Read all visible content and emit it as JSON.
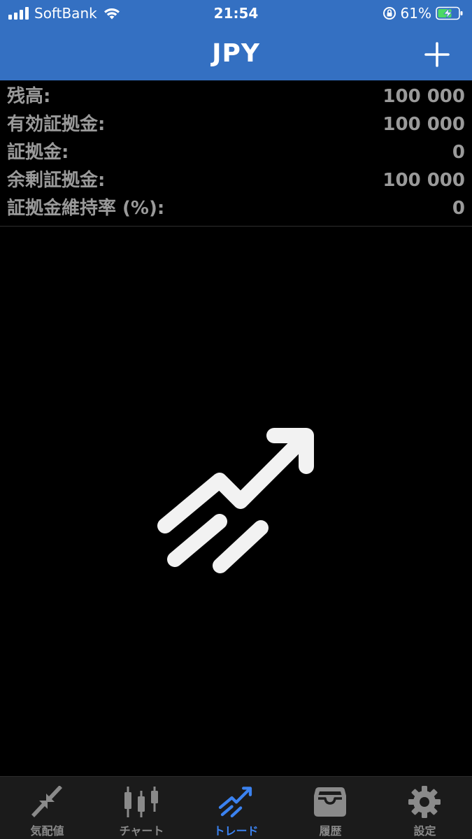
{
  "status_bar": {
    "carrier": "SoftBank",
    "time": "21:54",
    "battery_percent": "61%"
  },
  "nav": {
    "title": "JPY",
    "add_icon": "plus-icon"
  },
  "account": {
    "rows": [
      {
        "label": "残高:",
        "value": "100 000"
      },
      {
        "label": "有効証拠金:",
        "value": "100 000"
      },
      {
        "label": "証拠金:",
        "value": "0"
      },
      {
        "label": "余剰証拠金:",
        "value": "100 000"
      },
      {
        "label": "証拠金維持率 (%):",
        "value": "0"
      }
    ]
  },
  "empty_state": {
    "icon": "trade-trend-icon"
  },
  "tabbar": {
    "tabs": [
      {
        "label": "気配値",
        "icon": "quotes-icon",
        "active": false
      },
      {
        "label": "チャート",
        "icon": "candlestick-icon",
        "active": false
      },
      {
        "label": "トレード",
        "icon": "trade-icon",
        "active": true
      },
      {
        "label": "履歴",
        "icon": "inbox-icon",
        "active": false
      },
      {
        "label": "設定",
        "icon": "gear-icon",
        "active": false
      }
    ]
  },
  "colors": {
    "header_blue": "#3470c2",
    "active_tab": "#3b82f0",
    "inactive_tab": "#8a8a8a",
    "label_gray": "#9a9a9a",
    "background": "#000000"
  }
}
